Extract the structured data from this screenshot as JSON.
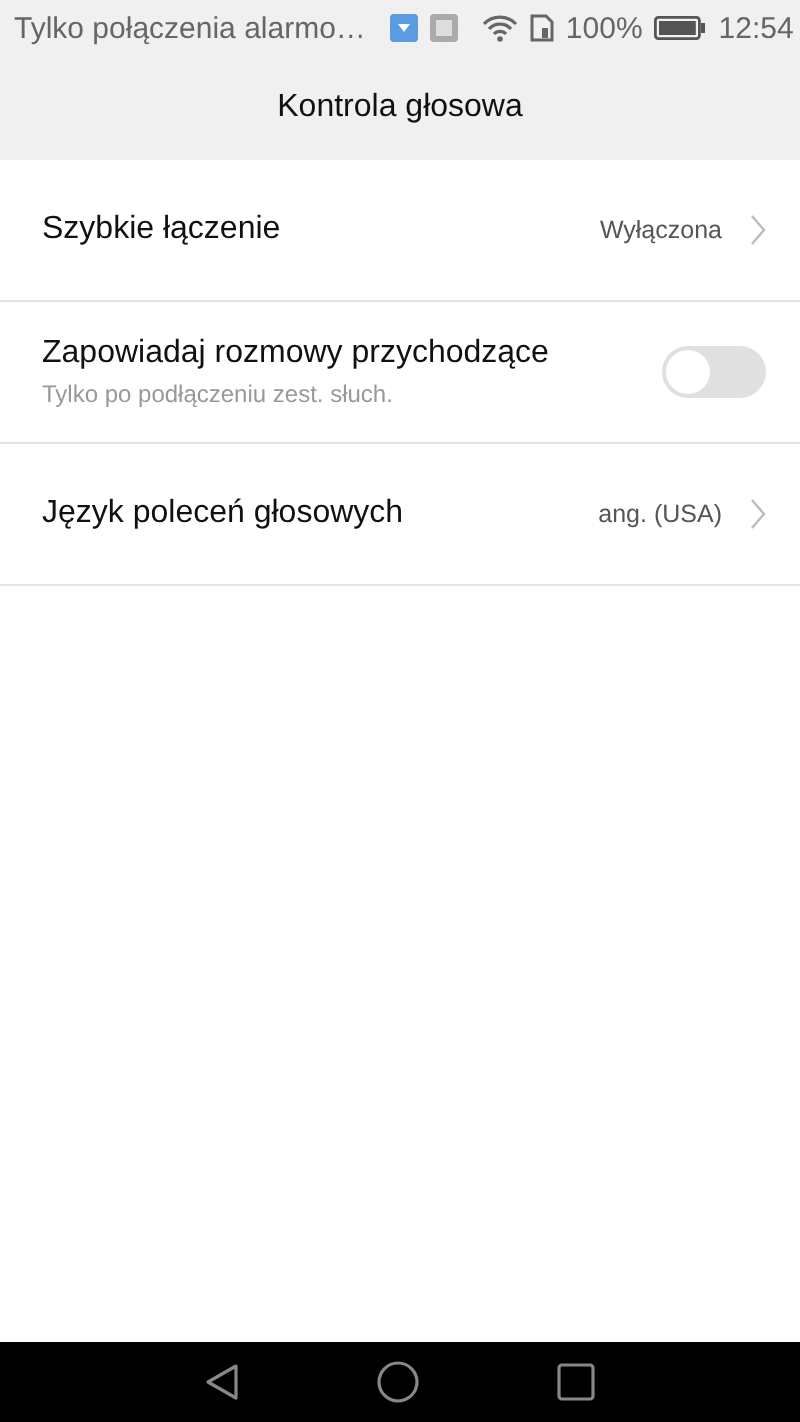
{
  "status_bar": {
    "notification": "Tylko połączenia alarmo…",
    "battery_percent": "100%",
    "time": "12:54"
  },
  "header": {
    "title": "Kontrola głosowa"
  },
  "settings": [
    {
      "kind": "link",
      "label": "Szybkie łączenie",
      "value": "Wyłączona"
    },
    {
      "kind": "toggle",
      "label": "Zapowiadaj rozmowy przychodzące",
      "subtitle": "Tylko po podłączeniu zest. słuch.",
      "on": false
    },
    {
      "kind": "link",
      "label": "Język poleceń głosowych",
      "value": "ang. (USA)"
    }
  ]
}
